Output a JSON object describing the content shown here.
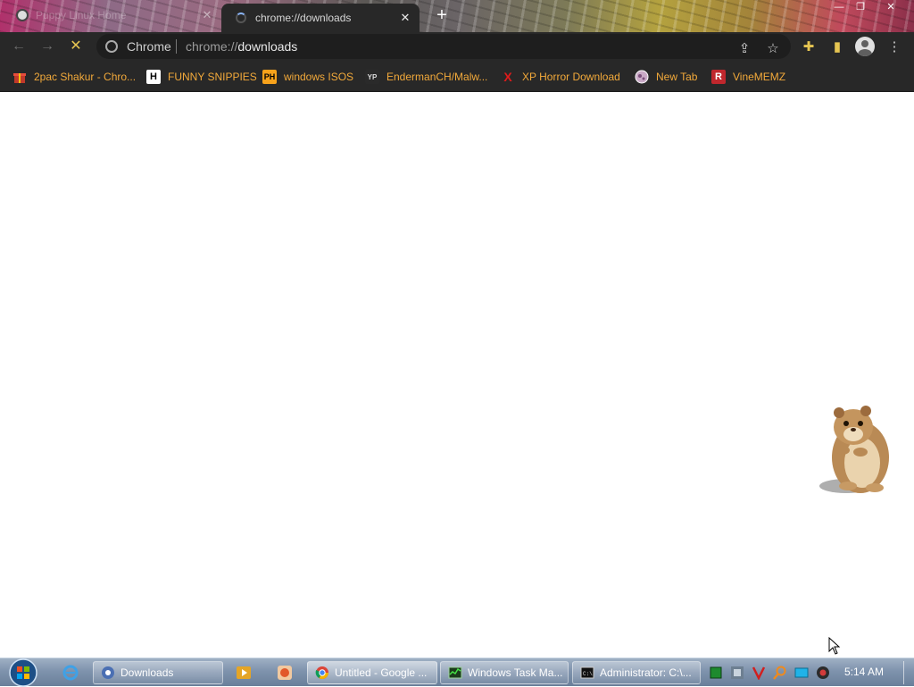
{
  "browser": {
    "tabs": [
      {
        "title": "Puppy Linux Home",
        "active": false,
        "favicon": "linux-favicon"
      },
      {
        "title": "chrome://downloads",
        "active": true,
        "favicon": "loading-spinner"
      }
    ],
    "new_tab_symbol": "+",
    "window_controls": [
      "minimize",
      "restore",
      "close"
    ],
    "omnibox": {
      "chip_label": "Chrome",
      "url_scheme": "chrome://",
      "url_host": "downloads"
    },
    "bookmarks": [
      {
        "label": "2pac Shakur - Chro...",
        "icon": "gift-icon"
      },
      {
        "label": "FUNNY SNIPPIES",
        "icon": "H"
      },
      {
        "label": "windows ISOS",
        "icon": "PH"
      },
      {
        "label": "EndermanCH/Malw...",
        "icon": "YP"
      },
      {
        "label": "XP Horror Download",
        "icon": "X"
      },
      {
        "label": "New Tab",
        "icon": "globe-icon"
      },
      {
        "label": "VineMEMZ",
        "icon": "R"
      }
    ]
  },
  "taskbar": {
    "tasks": [
      {
        "label": "Downloads",
        "active": false
      },
      {
        "label": "Untitled - Google ...",
        "active": true
      },
      {
        "label": "Windows Task Ma...",
        "active": false
      },
      {
        "label": "Administrator: C:\\...",
        "active": false
      }
    ],
    "clock": "5:14 AM"
  },
  "colors": {
    "browser_dark": "#282828",
    "bookmark_text": "#f2a93a",
    "stop_button": "#e6c552"
  }
}
